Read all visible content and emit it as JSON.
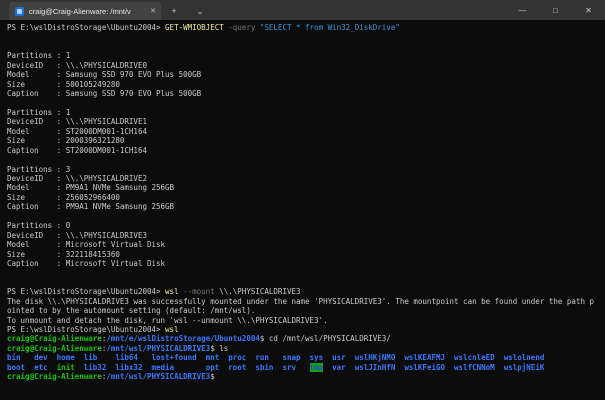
{
  "window": {
    "tab_title": "craig@Craig-Alienware: /mnt/v",
    "icons": {
      "tab_close": "✕",
      "new_tab": "+",
      "dropdown": "⌄",
      "minimize": "—",
      "maximize": "□",
      "close": "✕"
    },
    "colors": {
      "titlebar_bg": "#333333",
      "active_tab_bg": "#424242",
      "terminal_bg": "#0c0c0c",
      "default_fg": "#cccccc",
      "command_yellow": "#f2ec9e",
      "parameter_gray": "#767676",
      "string_blue": "#3a96dd",
      "prompt_green": "#16c60c",
      "path_blue": "#3b78ff",
      "tmp_highlight_bg": "#13a10e"
    }
  },
  "terminal": {
    "lines": [
      [
        {
          "t": "PS E:\\wslDistroStorage\\Ubuntu2004> ",
          "c": "fg"
        },
        {
          "t": "GET-WMIOBJECT",
          "c": "yellow"
        },
        {
          "t": " ",
          "c": "fg"
        },
        {
          "t": "-query",
          "c": "gray"
        },
        {
          "t": " ",
          "c": "fg"
        },
        {
          "t": "\"SELECT * from Win32_DiskDrive\"",
          "c": "str"
        }
      ],
      [],
      [],
      [
        {
          "t": "Partitions : 1",
          "c": "fg"
        }
      ],
      [
        {
          "t": "DeviceID   : \\\\.\\PHYSICALDRIVE0",
          "c": "fg"
        }
      ],
      [
        {
          "t": "Model      : Samsung SSD 970 EVO Plus 500GB",
          "c": "fg"
        }
      ],
      [
        {
          "t": "Size       : 500105249280",
          "c": "fg"
        }
      ],
      [
        {
          "t": "Caption    : Samsung SSD 970 EVO Plus 500GB",
          "c": "fg"
        }
      ],
      [],
      [
        {
          "t": "Partitions : 1",
          "c": "fg"
        }
      ],
      [
        {
          "t": "DeviceID   : \\\\.\\PHYSICALDRIVE1",
          "c": "fg"
        }
      ],
      [
        {
          "t": "Model      : ST2000DM001-1CH164",
          "c": "fg"
        }
      ],
      [
        {
          "t": "Size       : 2000396321280",
          "c": "fg"
        }
      ],
      [
        {
          "t": "Caption    : ST2000DM001-1CH164",
          "c": "fg"
        }
      ],
      [],
      [
        {
          "t": "Partitions : 3",
          "c": "fg"
        }
      ],
      [
        {
          "t": "DeviceID   : \\\\.\\PHYSICALDRIVE2",
          "c": "fg"
        }
      ],
      [
        {
          "t": "Model      : PM9A1 NVMe Samsung 256GB",
          "c": "fg"
        }
      ],
      [
        {
          "t": "Size       : 256052966400",
          "c": "fg"
        }
      ],
      [
        {
          "t": "Caption    : PM9A1 NVMe Samsung 256GB",
          "c": "fg"
        }
      ],
      [],
      [
        {
          "t": "Partitions : 0",
          "c": "fg"
        }
      ],
      [
        {
          "t": "DeviceID   : \\\\.\\PHYSICALDRIVE3",
          "c": "fg"
        }
      ],
      [
        {
          "t": "Model      : Microsoft Virtual Disk",
          "c": "fg"
        }
      ],
      [
        {
          "t": "Size       : 322118415360",
          "c": "fg"
        }
      ],
      [
        {
          "t": "Caption    : Microsoft Virtual Disk",
          "c": "fg"
        }
      ],
      [],
      [],
      [
        {
          "t": "PS E:\\wslDistroStorage\\Ubuntu2004> ",
          "c": "fg"
        },
        {
          "t": "wsl",
          "c": "yellow"
        },
        {
          "t": " ",
          "c": "fg"
        },
        {
          "t": "--mount",
          "c": "gray"
        },
        {
          "t": " \\\\.\\PHYSICALDRIVE3",
          "c": "fg"
        }
      ],
      [
        {
          "t": "The disk \\\\.\\PHYSICALDRIVE3 was successfully mounted under the name 'PHYSICALDRIVE3'. The mountpoint can be found under the path p",
          "c": "fg"
        }
      ],
      [
        {
          "t": "ointed to by the automount setting (default: /mnt/wsl).",
          "c": "fg"
        }
      ],
      [
        {
          "t": "To unmount and detach the disk, run 'wsl --unmount \\\\.\\PHYSICALDRIVE3'.",
          "c": "fg"
        }
      ],
      [
        {
          "t": "PS E:\\wslDistroStorage\\Ubuntu2004> ",
          "c": "fg"
        },
        {
          "t": "wsl",
          "c": "yellow"
        }
      ],
      [
        {
          "t": "craig@Craig-Alienware",
          "c": "green"
        },
        {
          "t": ":",
          "c": "fg"
        },
        {
          "t": "/mnt/e/wslDistroStorage/Ubuntu2004",
          "c": "blue"
        },
        {
          "t": "$ cd /mnt/wsl/PHYSICALDRIVE3/",
          "c": "fg"
        }
      ],
      [
        {
          "t": "craig@Craig-Alienware",
          "c": "green"
        },
        {
          "t": ":",
          "c": "fg"
        },
        {
          "t": "/mnt/wsl/PHYSICALDRIVE3",
          "c": "blue"
        },
        {
          "t": "$ ls",
          "c": "fg"
        }
      ],
      [
        {
          "t": "bin",
          "c": "blue"
        },
        {
          "t": "   ",
          "c": "fg"
        },
        {
          "t": "dev",
          "c": "blue"
        },
        {
          "t": "  ",
          "c": "fg"
        },
        {
          "t": "home",
          "c": "blue"
        },
        {
          "t": "  ",
          "c": "fg"
        },
        {
          "t": "lib",
          "c": "blue"
        },
        {
          "t": "    ",
          "c": "fg"
        },
        {
          "t": "lib64",
          "c": "blue"
        },
        {
          "t": "   ",
          "c": "fg"
        },
        {
          "t": "lost+found",
          "c": "blue"
        },
        {
          "t": "  ",
          "c": "fg"
        },
        {
          "t": "mnt",
          "c": "blue"
        },
        {
          "t": "  ",
          "c": "fg"
        },
        {
          "t": "proc",
          "c": "blue"
        },
        {
          "t": "  ",
          "c": "fg"
        },
        {
          "t": "run",
          "c": "blue"
        },
        {
          "t": "   ",
          "c": "fg"
        },
        {
          "t": "snap",
          "c": "blue"
        },
        {
          "t": "  ",
          "c": "fg"
        },
        {
          "t": "sys",
          "c": "blue"
        },
        {
          "t": "  ",
          "c": "fg"
        },
        {
          "t": "usr",
          "c": "blue"
        },
        {
          "t": "  ",
          "c": "fg"
        },
        {
          "t": "wslHKjNMO",
          "c": "blue"
        },
        {
          "t": "  ",
          "c": "fg"
        },
        {
          "t": "wslKEAFMJ",
          "c": "blue"
        },
        {
          "t": "  ",
          "c": "fg"
        },
        {
          "t": "wslcnleED",
          "c": "blue"
        },
        {
          "t": "  ",
          "c": "fg"
        },
        {
          "t": "wslolnend",
          "c": "blue"
        }
      ],
      [
        {
          "t": "boot",
          "c": "blue"
        },
        {
          "t": "  ",
          "c": "fg"
        },
        {
          "t": "etc",
          "c": "blue"
        },
        {
          "t": "  ",
          "c": "fg"
        },
        {
          "t": "init",
          "c": "green"
        },
        {
          "t": "  ",
          "c": "fg"
        },
        {
          "t": "lib32",
          "c": "blue"
        },
        {
          "t": "  ",
          "c": "fg"
        },
        {
          "t": "libx32",
          "c": "blue"
        },
        {
          "t": "  ",
          "c": "fg"
        },
        {
          "t": "media",
          "c": "blue"
        },
        {
          "t": "       ",
          "c": "fg"
        },
        {
          "t": "opt",
          "c": "blue"
        },
        {
          "t": "  ",
          "c": "fg"
        },
        {
          "t": "root",
          "c": "blue"
        },
        {
          "t": "  ",
          "c": "fg"
        },
        {
          "t": "sbin",
          "c": "blue"
        },
        {
          "t": "  ",
          "c": "fg"
        },
        {
          "t": "srv",
          "c": "blue"
        },
        {
          "t": "   ",
          "c": "fg"
        },
        {
          "t": "tmp",
          "c": "blue",
          "bg": "green"
        },
        {
          "t": "  ",
          "c": "fg"
        },
        {
          "t": "var",
          "c": "blue"
        },
        {
          "t": "  ",
          "c": "fg"
        },
        {
          "t": "wslJInHfN",
          "c": "blue"
        },
        {
          "t": "  ",
          "c": "fg"
        },
        {
          "t": "wslKFeiGO",
          "c": "blue"
        },
        {
          "t": "  ",
          "c": "fg"
        },
        {
          "t": "wslfCNNoM",
          "c": "blue"
        },
        {
          "t": "  ",
          "c": "fg"
        },
        {
          "t": "wslpjNEiK",
          "c": "blue"
        }
      ],
      [
        {
          "t": "craig@Craig-Alienware",
          "c": "green"
        },
        {
          "t": ":",
          "c": "fg"
        },
        {
          "t": "/mnt/wsl/PHYSICALDRIVE3",
          "c": "blue"
        },
        {
          "t": "$",
          "c": "fg"
        }
      ]
    ]
  }
}
